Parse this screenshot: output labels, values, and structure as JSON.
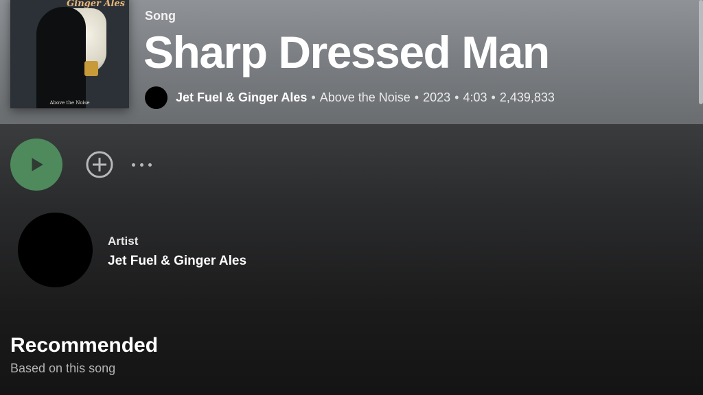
{
  "song": {
    "type_label": "Song",
    "title": "Sharp Dressed Man",
    "artist": "Jet Fuel & Ginger Ales",
    "album": "Above the Noise",
    "year": "2023",
    "duration": "4:03",
    "play_count": "2,439,833",
    "separator": "•"
  },
  "cover": {
    "title_text": "Ginger Ales",
    "subtitle_text": "Above the Noise"
  },
  "actions": {
    "play_icon": "play-icon",
    "add_icon": "add-circle-icon",
    "more_icon": "more-horizontal-icon",
    "play_color": "#4e8a5c"
  },
  "artist_section": {
    "label": "Artist",
    "name": "Jet Fuel & Ginger Ales"
  },
  "recommended": {
    "title": "Recommended",
    "subtitle": "Based on this song"
  }
}
